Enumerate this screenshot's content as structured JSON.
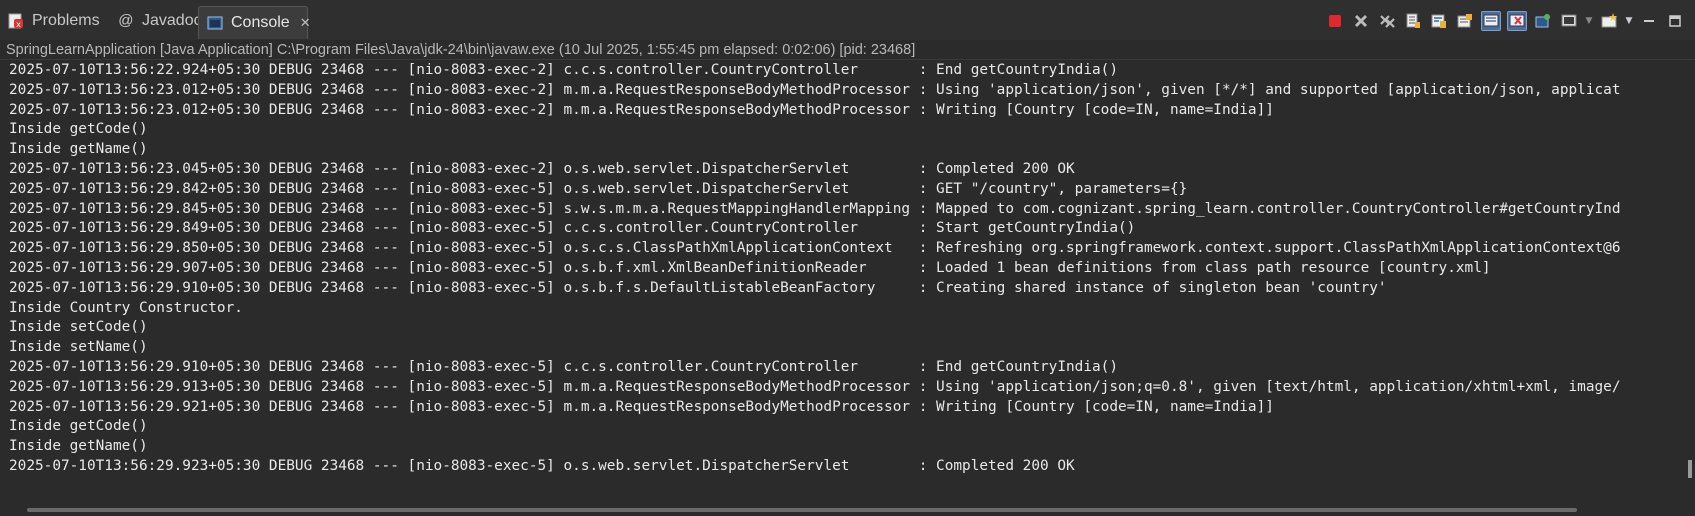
{
  "tabs": [
    {
      "label": "Problems",
      "icon": "problems-icon"
    },
    {
      "label": "Javadoc",
      "icon": "javadoc-icon"
    },
    {
      "label": "Console",
      "icon": "console-icon"
    }
  ],
  "active_tab_close": "✕",
  "status": "SpringLearnApplication [Java Application] C:\\Program Files\\Java\\jdk-24\\bin\\javaw.exe  (10 Jul 2025, 1:55:45 pm elapsed: 0:02:06) [pid: 23468]",
  "toolbar_icons": [
    "terminate-icon",
    "remove-launch-icon",
    "remove-all-terminated-icon",
    "scroll-lock-icon",
    "word-wrap-icon",
    "show-console-on-output-icon",
    "show-stdout-icon",
    "show-stderr-icon",
    "pin-console-icon",
    "display-console-icon",
    "display-console-dropdown-icon",
    "new-console-icon",
    "new-console-dropdown-icon",
    "minimize-icon",
    "maximize-icon"
  ],
  "colors": {
    "background": "#2b2b2b",
    "text": "#e8e8e8",
    "terminate": "#e0282e"
  },
  "console_lines": [
    "2025-07-10T13:56:22.924+05:30 DEBUG 23468 --- [nio-8083-exec-2] c.c.s.controller.CountryController       : End getCountryIndia()",
    "2025-07-10T13:56:23.012+05:30 DEBUG 23468 --- [nio-8083-exec-2] m.m.a.RequestResponseBodyMethodProcessor : Using 'application/json', given [*/*] and supported [application/json, applicat",
    "2025-07-10T13:56:23.012+05:30 DEBUG 23468 --- [nio-8083-exec-2] m.m.a.RequestResponseBodyMethodProcessor : Writing [Country [code=IN, name=India]]",
    "Inside getCode()",
    "Inside getName()",
    "2025-07-10T13:56:23.045+05:30 DEBUG 23468 --- [nio-8083-exec-2] o.s.web.servlet.DispatcherServlet        : Completed 200 OK",
    "2025-07-10T13:56:29.842+05:30 DEBUG 23468 --- [nio-8083-exec-5] o.s.web.servlet.DispatcherServlet        : GET \"/country\", parameters={}",
    "2025-07-10T13:56:29.845+05:30 DEBUG 23468 --- [nio-8083-exec-5] s.w.s.m.m.a.RequestMappingHandlerMapping : Mapped to com.cognizant.spring_learn.controller.CountryController#getCountryInd",
    "2025-07-10T13:56:29.849+05:30 DEBUG 23468 --- [nio-8083-exec-5] c.c.s.controller.CountryController       : Start getCountryIndia()",
    "2025-07-10T13:56:29.850+05:30 DEBUG 23468 --- [nio-8083-exec-5] o.s.c.s.ClassPathXmlApplicationContext   : Refreshing org.springframework.context.support.ClassPathXmlApplicationContext@6",
    "2025-07-10T13:56:29.907+05:30 DEBUG 23468 --- [nio-8083-exec-5] o.s.b.f.xml.XmlBeanDefinitionReader      : Loaded 1 bean definitions from class path resource [country.xml]",
    "2025-07-10T13:56:29.910+05:30 DEBUG 23468 --- [nio-8083-exec-5] o.s.b.f.s.DefaultListableBeanFactory     : Creating shared instance of singleton bean 'country'",
    "Inside Country Constructor.",
    "Inside setCode()",
    "Inside setName()",
    "2025-07-10T13:56:29.910+05:30 DEBUG 23468 --- [nio-8083-exec-5] c.c.s.controller.CountryController       : End getCountryIndia()",
    "2025-07-10T13:56:29.913+05:30 DEBUG 23468 --- [nio-8083-exec-5] m.m.a.RequestResponseBodyMethodProcessor : Using 'application/json;q=0.8', given [text/html, application/xhtml+xml, image/",
    "2025-07-10T13:56:29.921+05:30 DEBUG 23468 --- [nio-8083-exec-5] m.m.a.RequestResponseBodyMethodProcessor : Writing [Country [code=IN, name=India]]",
    "Inside getCode()",
    "Inside getName()",
    "2025-07-10T13:56:29.923+05:30 DEBUG 23468 --- [nio-8083-exec-5] o.s.web.servlet.DispatcherServlet        : Completed 200 OK"
  ]
}
